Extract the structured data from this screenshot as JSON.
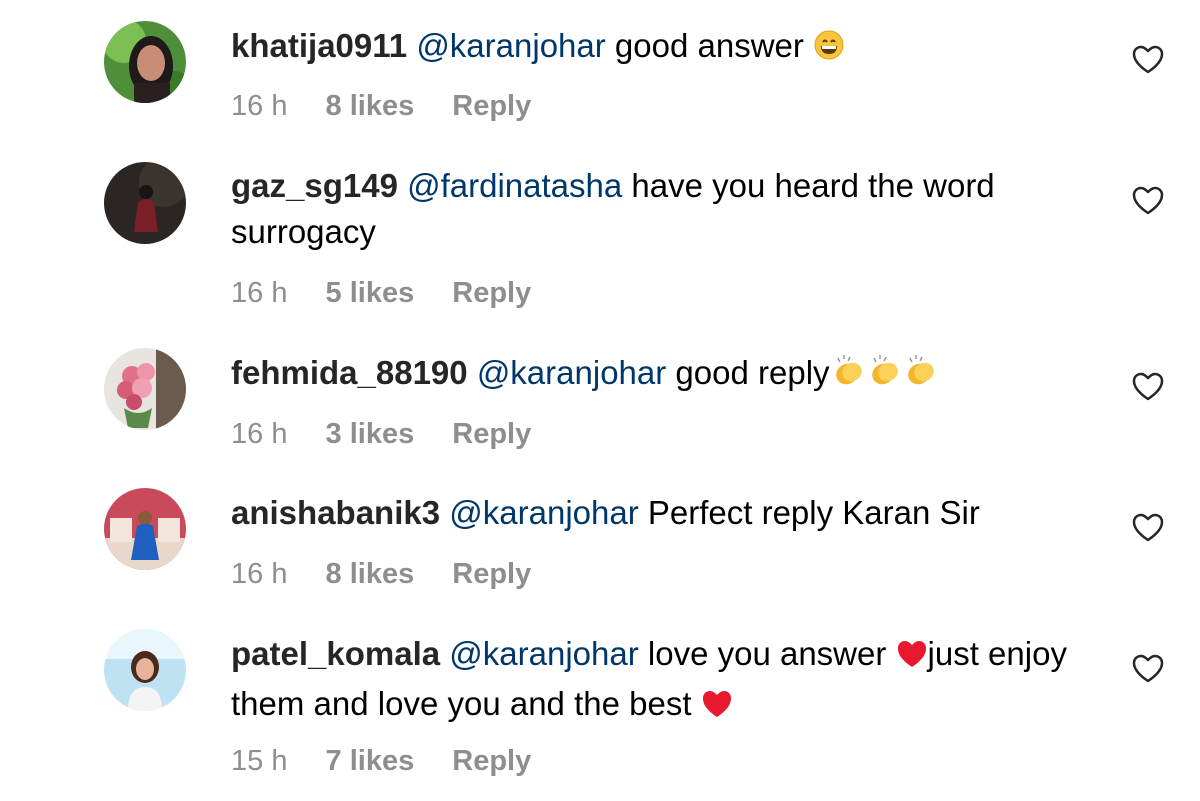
{
  "comments": [
    {
      "username": "khatija0911",
      "mention": "@karanjohar",
      "text": " good answer",
      "time": "16 h",
      "likes": "8 likes",
      "reply": "Reply",
      "avatar": "avatar-woman-portrait",
      "emoji": "grinning-face-icon"
    },
    {
      "username": "gaz_sg149",
      "mention": "@fardinatasha",
      "text": " have you heard the word surrogacy",
      "time": "16 h",
      "likes": "5 likes",
      "reply": "Reply",
      "avatar": "avatar-dark-figure"
    },
    {
      "username": "fehmida_88190",
      "mention": "@karanjohar",
      "text": " good reply",
      "time": "16 h",
      "likes": "3 likes",
      "reply": "Reply",
      "avatar": "avatar-flowers",
      "emoji": "clapping-hands-icon"
    },
    {
      "username": "anishabanik3",
      "mention": "@karanjohar",
      "text": " Perfect reply Karan Sir",
      "time": "16 h",
      "likes": "8 likes",
      "reply": "Reply",
      "avatar": "avatar-person-in-blue"
    },
    {
      "username": "patel_komala",
      "mention": "@karanjohar",
      "text": " love you answer ",
      "text2": "just enjoy them and love you and the best ",
      "time": "15 h",
      "likes": "7 likes",
      "reply": "Reply",
      "avatar": "avatar-woman-smiling",
      "emoji": "red-heart-icon"
    }
  ],
  "icons": {
    "like": "heart-outline-icon"
  },
  "colors": {
    "username": "#262626",
    "mention": "#00376b",
    "meta": "#8e8e8e"
  }
}
